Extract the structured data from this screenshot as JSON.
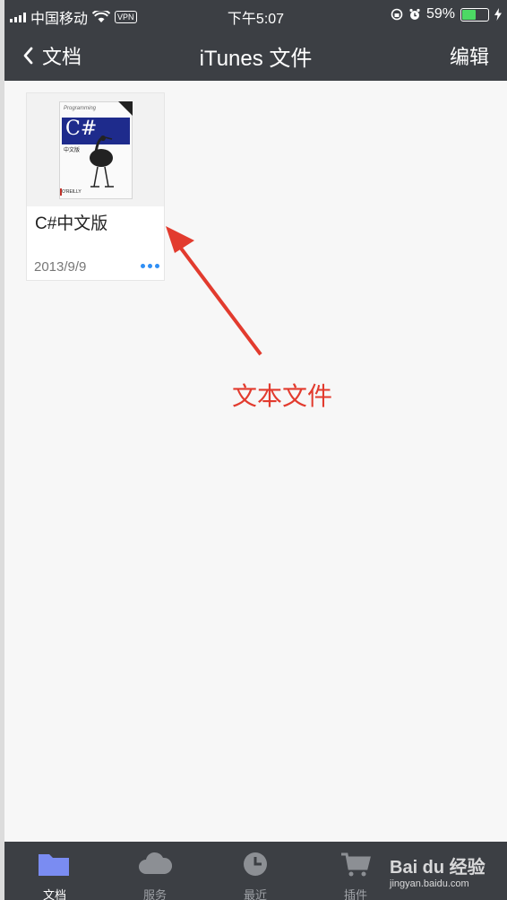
{
  "status_bar": {
    "carrier": "中国移动",
    "vpn": "VPN",
    "time": "下午5:07",
    "battery_pct": "59%",
    "battery_level": 0.59,
    "battery_color": "#4cd964"
  },
  "nav": {
    "back_label": "文档",
    "title": "iTunes 文件",
    "edit_label": "编辑"
  },
  "file": {
    "name": "C#中文版",
    "date": "2013/9/9",
    "more_icon": "more-dots-icon",
    "cover": {
      "top": "Programming",
      "band": "C#",
      "sub": "中文版",
      "brand": "O'REILLY"
    }
  },
  "annotation": {
    "text": "文本文件",
    "color": "#e23b2e"
  },
  "tabs": [
    {
      "label": "文档",
      "icon": "folder-icon",
      "active": true
    },
    {
      "label": "服务",
      "icon": "cloud-icon",
      "active": false
    },
    {
      "label": "最近",
      "icon": "clock-icon",
      "active": false
    },
    {
      "label": "插件",
      "icon": "cart-icon",
      "active": false
    }
  ],
  "watermark": {
    "brand": "Bai du 经验",
    "url": "jingyan.baidu.com"
  },
  "colors": {
    "bar": "#3c3f44",
    "accent": "#2f8ff5",
    "active_tab": "#7a8cf2"
  }
}
